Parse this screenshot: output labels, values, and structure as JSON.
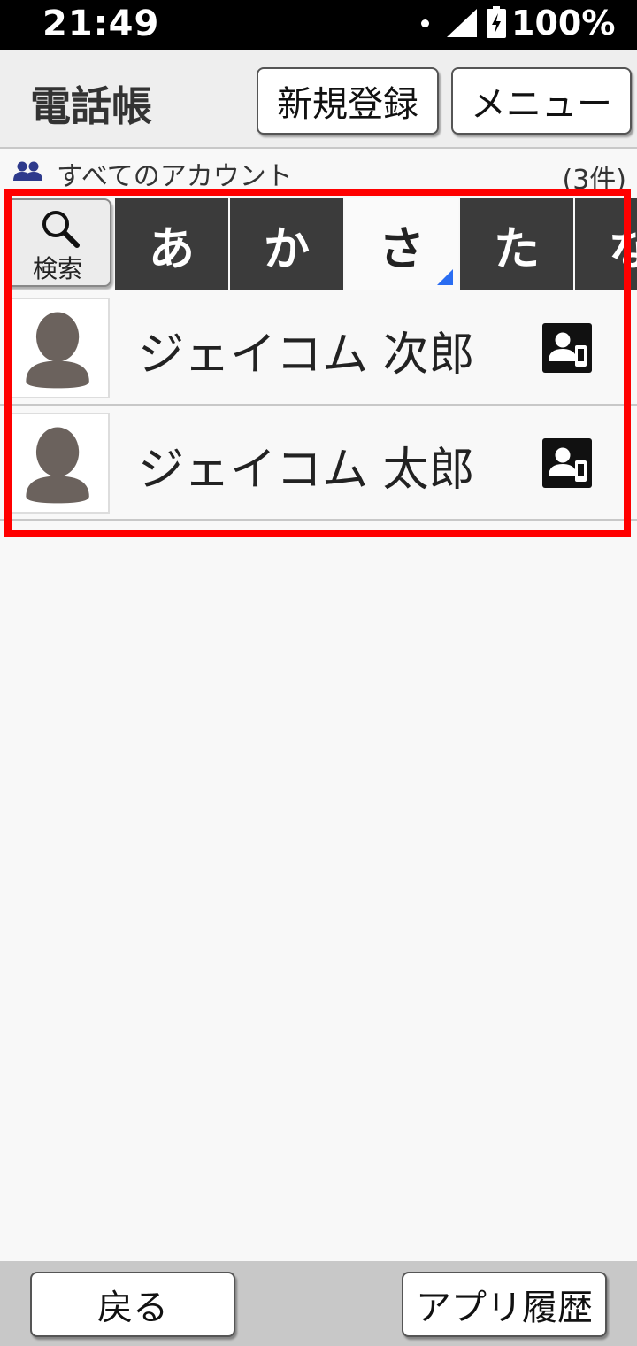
{
  "status_bar": {
    "time": "21:49",
    "battery_percent": "100%"
  },
  "header": {
    "title": "電話帳",
    "new_button_label": "新規登録",
    "menu_button_label": "メニュー"
  },
  "account": {
    "label": "すべてのアカウント",
    "count": "(3件)"
  },
  "index_tabs": {
    "search_label": "検索",
    "kana": [
      "あ",
      "か",
      "さ",
      "た",
      "な"
    ],
    "active": "さ"
  },
  "contacts": [
    {
      "name": "ジェイコム 次郎"
    },
    {
      "name": "ジェイコム 太郎"
    }
  ],
  "footer": {
    "back_label": "戻る",
    "history_label": "アプリ履歴"
  },
  "colors": {
    "highlight": "#ff0000",
    "active_marker": "#2a6df2",
    "tab_dark": "#3b3b3b"
  }
}
